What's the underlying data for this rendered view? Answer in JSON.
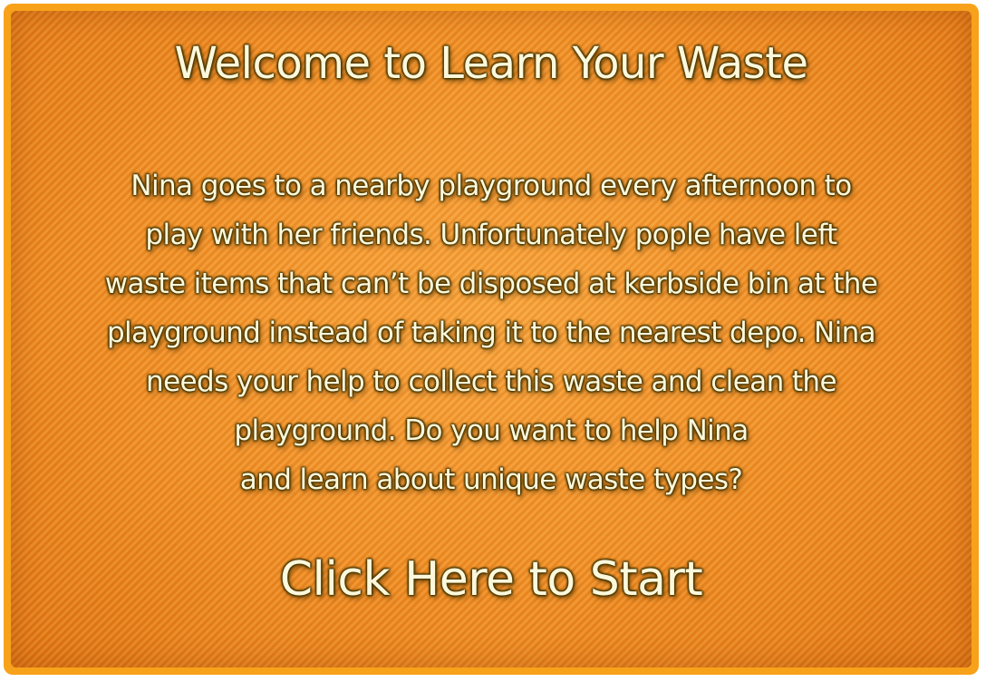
{
  "title": "Welcome to Learn Your Waste",
  "story_lines": [
    "Nina goes to a nearby playground every afternoon to",
    "play with her friends. Unfortunately pople have left",
    "waste items that can’t be disposed at kerbside bin at the",
    "playground instead of taking it to the nearest depo. Nina",
    "needs your help to collect this waste and clean the",
    "playground. Do you want to help Nina",
    "and learn about unique waste types?"
  ],
  "start_label": "Click Here to Start",
  "colors": {
    "border": "#f7a21a",
    "panel": "#ee8a1c",
    "text": "#fbf8dc",
    "text_outline": "#4e3a00"
  }
}
